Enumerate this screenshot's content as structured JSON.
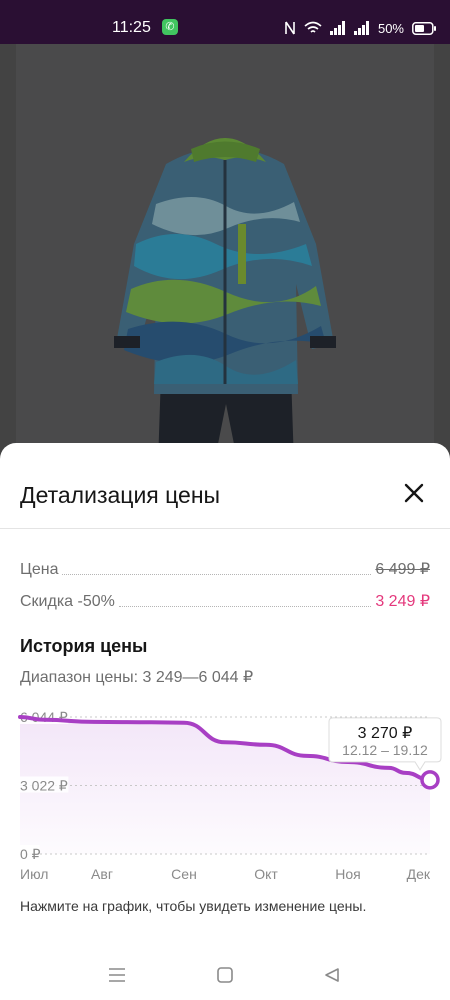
{
  "status_bar": {
    "time": "11:25",
    "battery": "50%",
    "icons": [
      "phone-call-icon",
      "nfc-icon",
      "wifi-icon",
      "signal-icon",
      "signal-icon",
      "battery-icon"
    ]
  },
  "product": {
    "image": "kids-winter-jumpsuit-photo"
  },
  "sheet": {
    "title": "Детализация цены",
    "close_icon": "close-icon"
  },
  "prices": {
    "price_label": "Цена",
    "price_value": "6 499 ₽",
    "discount_label": "Скидка -50%",
    "discount_value": "3 249 ₽"
  },
  "history": {
    "title": "История цены",
    "range": "Диапазон цены: 3 249—6 044 ₽",
    "hint": "Нажмите на график, чтобы увидеть изменение цены."
  },
  "chart_data": {
    "type": "line",
    "x": [
      "Июл",
      "Авг",
      "Сен",
      "Окт",
      "Ноя",
      "Дек"
    ],
    "y_ticks": [
      "6 044 ₽",
      "3 022 ₽",
      "0 ₽"
    ],
    "ylim": [
      0,
      6044
    ],
    "series": [
      {
        "points": [
          [
            0.0,
            6044
          ],
          [
            0.3,
            5920
          ],
          [
            0.9,
            5830
          ],
          [
            1.6,
            5810
          ],
          [
            2.0,
            5790
          ],
          [
            2.5,
            4930
          ],
          [
            3.0,
            4820
          ],
          [
            3.5,
            4330
          ],
          [
            4.0,
            4060
          ],
          [
            4.5,
            3800
          ],
          [
            4.7,
            3580
          ],
          [
            5.0,
            3270
          ]
        ]
      }
    ],
    "tooltip": {
      "value": "3 270 ₽",
      "date": "12.12 – 19.12"
    },
    "colors": {
      "line": "#a83fc4",
      "marker_fill": "#ffffff",
      "area": "#f3e6f8",
      "grid": "#c8c8c8",
      "axis_text": "#8a8a8a"
    },
    "grid": true
  },
  "nav": {
    "icons": [
      "menu-icon",
      "home-square-icon",
      "back-triangle-icon"
    ]
  }
}
